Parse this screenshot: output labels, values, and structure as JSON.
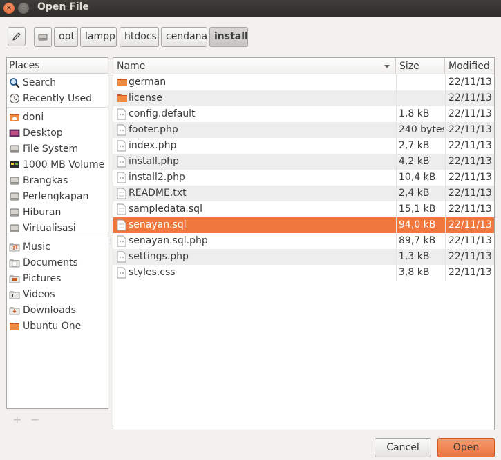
{
  "window": {
    "title": "Open File",
    "close_glyph": "×",
    "minimize_glyph": "–"
  },
  "pathbar": {
    "edit_icon": "pencil-icon",
    "drive_icon": "drive-icon",
    "crumbs": [
      "opt",
      "lampp",
      "htdocs",
      "cendana",
      "install"
    ],
    "active_index": 4
  },
  "places": {
    "header": "Places",
    "items": [
      {
        "label": "Search",
        "icon": "search-icon"
      },
      {
        "label": "Recently Used",
        "icon": "recent-icon"
      },
      {
        "label": "doni",
        "icon": "home-folder-icon"
      },
      {
        "label": "Desktop",
        "icon": "desktop-icon"
      },
      {
        "label": "File System",
        "icon": "drive-icon"
      },
      {
        "label": "1000 MB Volume",
        "icon": "usb-drive-icon"
      },
      {
        "label": "Brangkas",
        "icon": "drive-icon"
      },
      {
        "label": "Perlengkapan",
        "icon": "drive-icon"
      },
      {
        "label": "Hiburan",
        "icon": "drive-icon"
      },
      {
        "label": "Virtualisasi",
        "icon": "drive-icon"
      },
      {
        "label": "Music",
        "icon": "music-folder-icon"
      },
      {
        "label": "Documents",
        "icon": "documents-folder-icon"
      },
      {
        "label": "Pictures",
        "icon": "pictures-folder-icon"
      },
      {
        "label": "Videos",
        "icon": "videos-folder-icon"
      },
      {
        "label": "Downloads",
        "icon": "downloads-folder-icon"
      },
      {
        "label": "Ubuntu One",
        "icon": "folder-icon"
      }
    ],
    "add_glyph": "+",
    "remove_glyph": "−"
  },
  "files": {
    "columns": {
      "name": "Name",
      "size": "Size",
      "modified": "Modified"
    },
    "selected_index": 9,
    "rows": [
      {
        "name": "german",
        "size": "",
        "modified": "22/11/13",
        "type": "folder"
      },
      {
        "name": "license",
        "size": "",
        "modified": "22/11/13",
        "type": "folder"
      },
      {
        "name": "config.default",
        "size": "1,8 kB",
        "modified": "22/11/13",
        "type": "code"
      },
      {
        "name": "footer.php",
        "size": "240 bytes",
        "modified": "22/11/13",
        "type": "code"
      },
      {
        "name": "index.php",
        "size": "2,7 kB",
        "modified": "22/11/13",
        "type": "code"
      },
      {
        "name": "install.php",
        "size": "4,2 kB",
        "modified": "22/11/13",
        "type": "code"
      },
      {
        "name": "install2.php",
        "size": "10,4 kB",
        "modified": "22/11/13",
        "type": "code"
      },
      {
        "name": "README.txt",
        "size": "2,4 kB",
        "modified": "22/11/13",
        "type": "text"
      },
      {
        "name": "sampledata.sql",
        "size": "15,1 kB",
        "modified": "22/11/13",
        "type": "text"
      },
      {
        "name": "senayan.sql",
        "size": "94,0 kB",
        "modified": "22/11/13",
        "type": "text"
      },
      {
        "name": "senayan.sql.php",
        "size": "89,7 kB",
        "modified": "22/11/13",
        "type": "code"
      },
      {
        "name": "settings.php",
        "size": "1,3 kB",
        "modified": "22/11/13",
        "type": "code"
      },
      {
        "name": "styles.css",
        "size": "3,8 kB",
        "modified": "22/11/13",
        "type": "code"
      }
    ]
  },
  "buttons": {
    "cancel": "Cancel",
    "open": "Open"
  },
  "colors": {
    "accent": "#f0773e",
    "folder": "#f08a3e"
  }
}
